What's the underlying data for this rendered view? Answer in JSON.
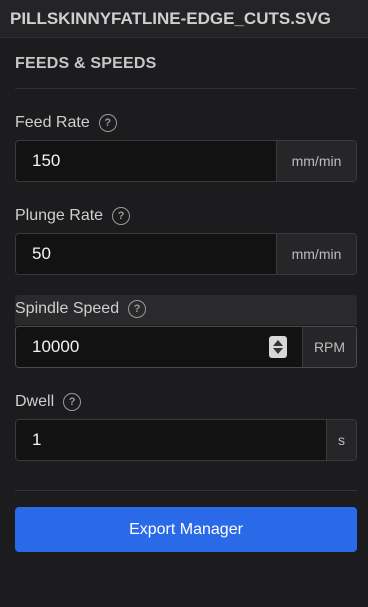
{
  "window": {
    "title": "PILLSKINNYFATLINE-EDGE_CUTS.SVG"
  },
  "section": {
    "title": "FEEDS & SPEEDS"
  },
  "fields": {
    "feed_rate": {
      "label": "Feed Rate",
      "value": "150",
      "unit": "mm/min",
      "help_icon": "question-circle-icon"
    },
    "plunge_rate": {
      "label": "Plunge Rate",
      "value": "50",
      "unit": "mm/min",
      "help_icon": "question-circle-icon"
    },
    "spindle_speed": {
      "label": "Spindle Speed",
      "value": "10000",
      "unit": "RPM",
      "help_icon": "question-circle-icon"
    },
    "dwell": {
      "label": "Dwell",
      "value": "1",
      "unit": "s",
      "help_icon": "question-circle-icon"
    }
  },
  "help_symbol": "?",
  "actions": {
    "export_label": "Export Manager"
  },
  "colors": {
    "background": "#1c1c1e",
    "accent": "#2a6ae8",
    "input_bg": "#121212"
  }
}
